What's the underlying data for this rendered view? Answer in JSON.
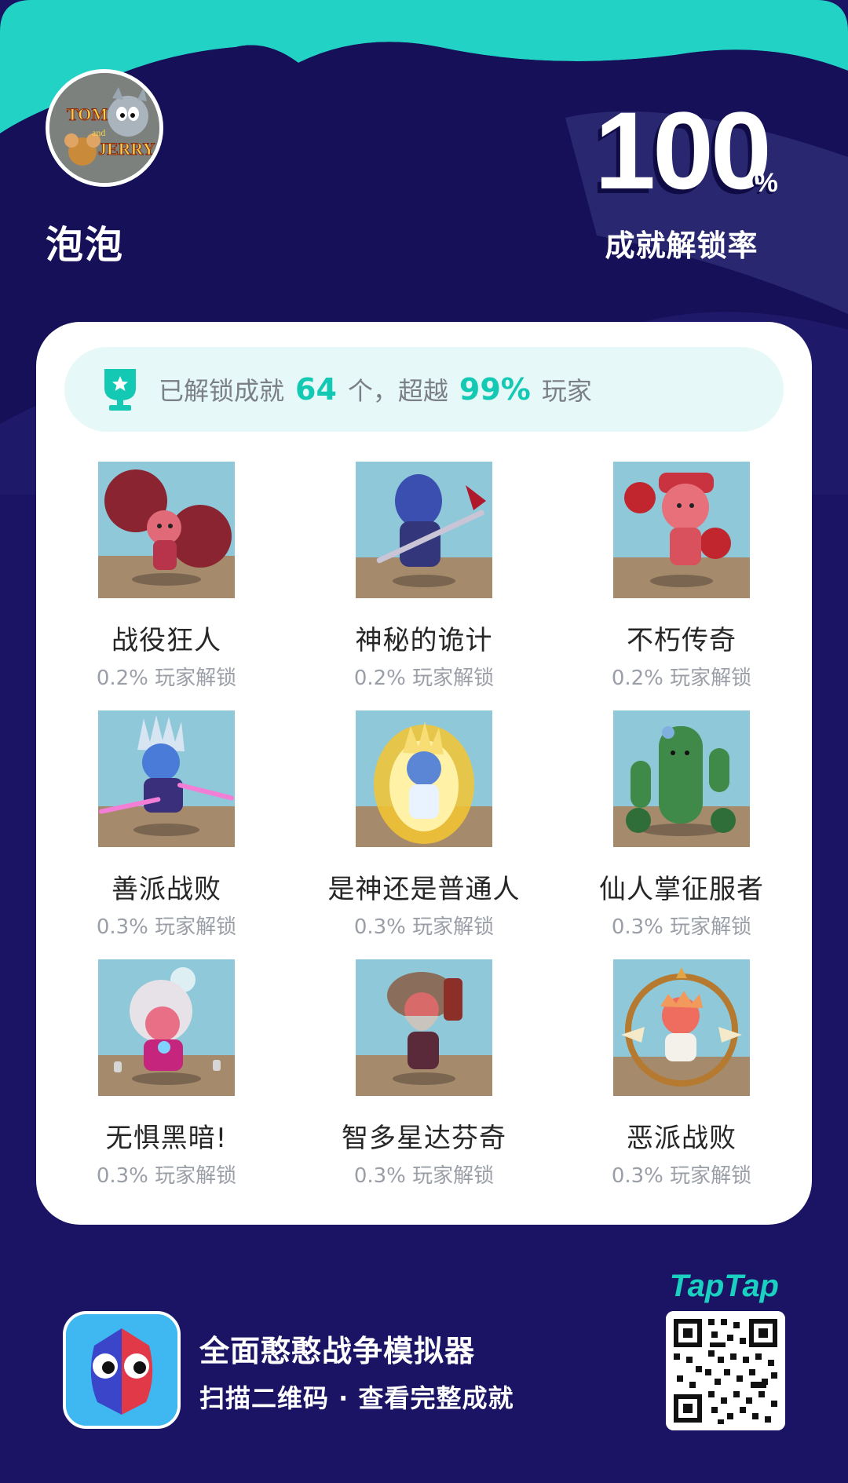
{
  "profile": {
    "nickname": "泡泡",
    "avatar_icon": "tom-and-jerry-avatar",
    "avatar_text_line1": "TOM",
    "avatar_text_line2": "and",
    "avatar_text_line3": "JERRY"
  },
  "unlock_rate": {
    "value": "100",
    "unit": "%",
    "label": "成就解锁率"
  },
  "summary": {
    "prefix": "已解锁成就",
    "count": "64",
    "middle": "个，超越",
    "percent": "99%",
    "suffix": "玩家"
  },
  "achievements": [
    {
      "name": "战役狂人",
      "rate": "0.2% 玩家解锁",
      "icon": "pink-cheerleader-character"
    },
    {
      "name": "神秘的诡计",
      "rate": "0.2% 玩家解锁",
      "icon": "hooded-blue-knight-character"
    },
    {
      "name": "不朽传奇",
      "rate": "0.2% 玩家解锁",
      "icon": "red-boxer-character"
    },
    {
      "name": "善派战败",
      "rate": "0.3% 玩家解锁",
      "icon": "ice-ninja-character"
    },
    {
      "name": "是神还是普通人",
      "rate": "0.3% 玩家解锁",
      "icon": "golden-aura-character"
    },
    {
      "name": "仙人掌征服者",
      "rate": "0.3% 玩家解锁",
      "icon": "cactus-character"
    },
    {
      "name": "无惧黑暗!",
      "rate": "0.3% 玩家解锁",
      "icon": "white-haired-sorcerer-character"
    },
    {
      "name": "智多星达芬奇",
      "rate": "0.3% 玩家解锁",
      "icon": "da-vinci-character"
    },
    {
      "name": "恶派战败",
      "rate": "0.3% 玩家解锁",
      "icon": "sun-ring-character"
    }
  ],
  "footer": {
    "game_title": "全面憨憨战争模拟器",
    "subtitle": "扫描二维码 · 查看完整成就",
    "brand": "TapTap",
    "app_icon": "red-blue-wobbler-app-icon",
    "qr_icon": "qr-code"
  },
  "colors": {
    "background": "#1b1464",
    "accent_teal": "#14c9b4",
    "top_wave": "#22d3c5",
    "card": "#ffffff"
  }
}
